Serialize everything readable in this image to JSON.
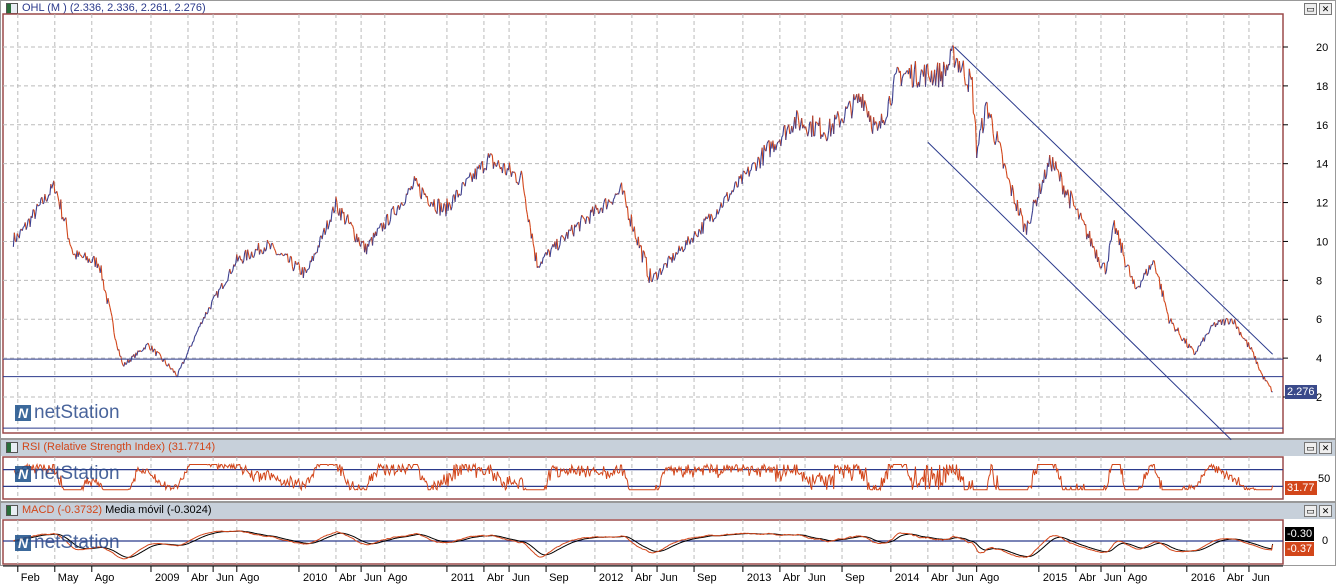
{
  "windows": {
    "price": {
      "title": "OHL (M ) (2.336, 2.336, 2.261, 2.276)",
      "last_label": "2.276",
      "btn_restore": "▭",
      "btn_close": "✕"
    },
    "rsi": {
      "title": "RSI (Relative Strength Index) (31.7714)",
      "last_label": "31.77",
      "level_label": "50",
      "btn_restore": "▭",
      "btn_close": "✕"
    },
    "macd": {
      "title": "MACD (-0.3732)",
      "ma_title": "Media móvil (-0.3024)",
      "macd_label": "-0.37",
      "ma_label": "-0.30",
      "zero_label": "0",
      "btn_restore": "▭",
      "btn_close": "✕"
    }
  },
  "watermark": {
    "brand": "netStation"
  },
  "colors": {
    "up": "#3b3f8f",
    "down": "#d2461a",
    "line": "#2b3a8c",
    "grid": "#bbbbbb",
    "frame": "#9b4a4a",
    "header": "#c7d0da",
    "macd": "#000000",
    "signal": "#d2461a"
  },
  "chart_data": {
    "type": "line",
    "title": "OHL (M )",
    "ylim": [
      0,
      21
    ],
    "yticks": [
      2,
      4,
      6,
      8,
      10,
      12,
      14,
      16,
      18,
      20
    ],
    "xlim": [
      2008.0,
      2016.65
    ],
    "xticks": [
      {
        "t": 2008.1,
        "label": "Feb"
      },
      {
        "t": 2008.35,
        "label": "May"
      },
      {
        "t": 2008.6,
        "label": "Ago"
      },
      {
        "t": 2009.0,
        "label": "2009"
      },
      {
        "t": 2009.25,
        "label": "Abr"
      },
      {
        "t": 2009.42,
        "label": "Jun"
      },
      {
        "t": 2009.58,
        "label": "Ago"
      },
      {
        "t": 2010.0,
        "label": "2010"
      },
      {
        "t": 2010.25,
        "label": "Abr"
      },
      {
        "t": 2010.42,
        "label": "Jun"
      },
      {
        "t": 2010.58,
        "label": "Ago"
      },
      {
        "t": 2011.0,
        "label": "2011"
      },
      {
        "t": 2011.25,
        "label": "Abr"
      },
      {
        "t": 2011.42,
        "label": "Jun"
      },
      {
        "t": 2011.67,
        "label": "Sep"
      },
      {
        "t": 2012.0,
        "label": "2012"
      },
      {
        "t": 2012.25,
        "label": "Abr"
      },
      {
        "t": 2012.42,
        "label": "Jun"
      },
      {
        "t": 2012.67,
        "label": "Sep"
      },
      {
        "t": 2013.0,
        "label": "2013"
      },
      {
        "t": 2013.25,
        "label": "Abr"
      },
      {
        "t": 2013.42,
        "label": "Jun"
      },
      {
        "t": 2013.67,
        "label": "Sep"
      },
      {
        "t": 2014.0,
        "label": "2014"
      },
      {
        "t": 2014.25,
        "label": "Abr"
      },
      {
        "t": 2014.42,
        "label": "Jun"
      },
      {
        "t": 2014.58,
        "label": "Ago"
      },
      {
        "t": 2015.0,
        "label": "2015"
      },
      {
        "t": 2015.25,
        "label": "Abr"
      },
      {
        "t": 2015.42,
        "label": "Jun"
      },
      {
        "t": 2015.58,
        "label": "Ago"
      },
      {
        "t": 2016.0,
        "label": "2016"
      },
      {
        "t": 2016.25,
        "label": "Abr"
      },
      {
        "t": 2016.42,
        "label": "Jun"
      }
    ],
    "price": [
      [
        2008.07,
        10.1
      ],
      [
        2008.11,
        10.3
      ],
      [
        2008.35,
        12.9
      ],
      [
        2008.48,
        9.3
      ],
      [
        2008.65,
        8.9
      ],
      [
        2008.75,
        5.4
      ],
      [
        2008.81,
        3.6
      ],
      [
        2008.98,
        4.7
      ],
      [
        2009.18,
        3.1
      ],
      [
        2009.35,
        6
      ],
      [
        2009.58,
        9
      ],
      [
        2009.78,
        9.8
      ],
      [
        2010.05,
        8.3
      ],
      [
        2010.25,
        11.9
      ],
      [
        2010.45,
        9.6
      ],
      [
        2010.78,
        12.9
      ],
      [
        2010.98,
        11.6
      ],
      [
        2011.28,
        14.2
      ],
      [
        2011.51,
        13.2
      ],
      [
        2011.61,
        8.8
      ],
      [
        2011.85,
        10.6
      ],
      [
        2012.18,
        12.6
      ],
      [
        2012.38,
        8
      ],
      [
        2012.71,
        10.6
      ],
      [
        2013.11,
        14.2
      ],
      [
        2013.35,
        16.2
      ],
      [
        2013.58,
        15.7
      ],
      [
        2013.81,
        17.5
      ],
      [
        2013.91,
        15.5
      ],
      [
        2014.05,
        18.6
      ],
      [
        2014.35,
        18.6
      ],
      [
        2014.43,
        19.6
      ],
      [
        2014.55,
        18
      ],
      [
        2014.58,
        14.7
      ],
      [
        2014.65,
        17
      ],
      [
        2014.78,
        13.4
      ],
      [
        2014.91,
        10.6
      ],
      [
        2015.08,
        14.2
      ],
      [
        2015.25,
        11.6
      ],
      [
        2015.45,
        8.5
      ],
      [
        2015.51,
        10.8
      ],
      [
        2015.65,
        7.5
      ],
      [
        2015.78,
        9
      ],
      [
        2015.88,
        6
      ],
      [
        2016.05,
        4.2
      ],
      [
        2016.18,
        5.7
      ],
      [
        2016.31,
        6
      ],
      [
        2016.45,
        4.2
      ],
      [
        2016.51,
        3.1
      ],
      [
        2016.58,
        2.276
      ]
    ],
    "hlines": [
      3.95,
      3.05,
      0.4
    ],
    "channel": [
      [
        [
          2014.43,
          20
        ],
        [
          2016.58,
          4.2
        ]
      ],
      [
        [
          2014.25,
          15.1
        ],
        [
          2016.3,
          -0.2
        ]
      ]
    ],
    "rsi": {
      "levels": [
        30,
        70
      ],
      "ylim": [
        0,
        100
      ],
      "last": 31.77
    },
    "macd": {
      "last": -0.3732,
      "signal": -0.3024,
      "ylim": [
        -2,
        2
      ]
    }
  }
}
